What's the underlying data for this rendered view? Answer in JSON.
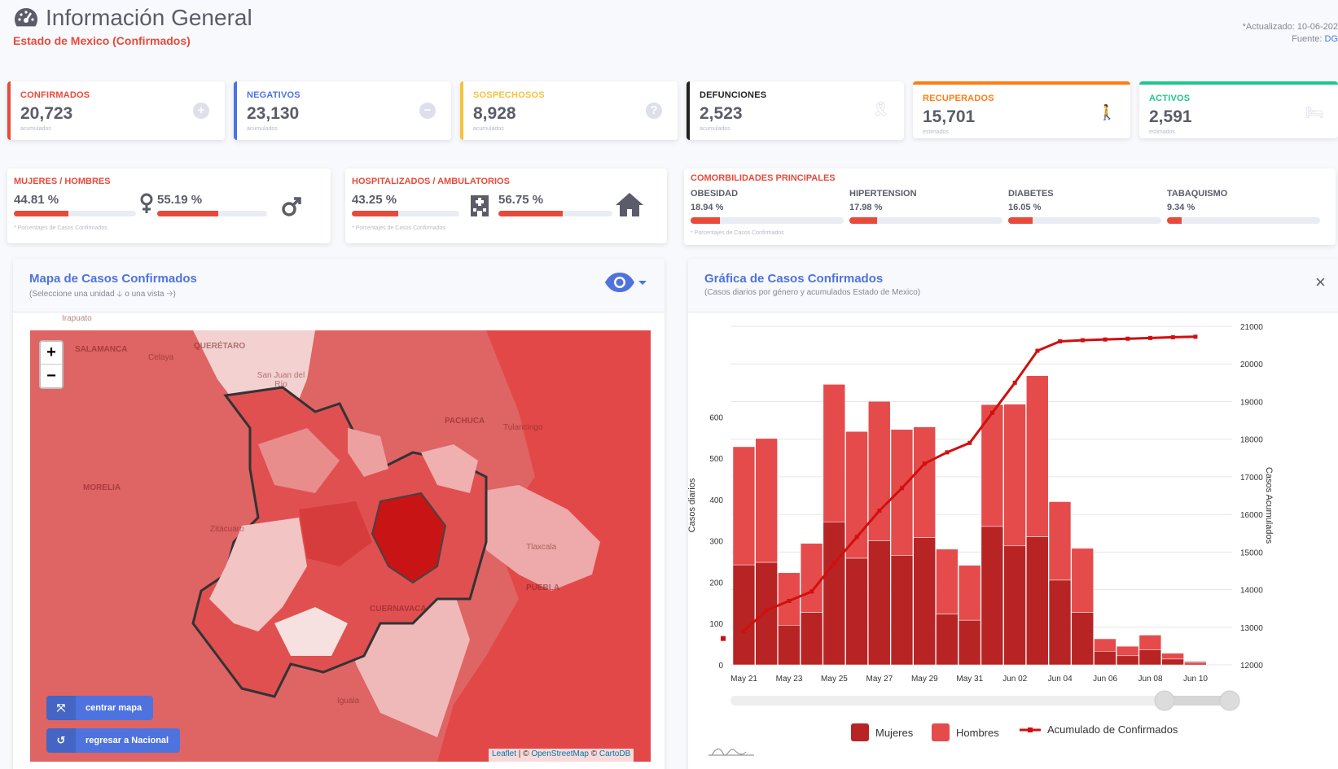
{
  "header": {
    "title": "Información General",
    "subtitle": "Estado de Mexico (Confirmados)",
    "updated": "*Actualizado: 10-06-202",
    "source_label": "Fuente:",
    "source_link": "DG"
  },
  "stats": [
    {
      "label": "CONFIRMADOS",
      "value": "20,723",
      "sub": "acumulados",
      "color": "#e74a3b",
      "icon": "plus-circle-icon"
    },
    {
      "label": "NEGATIVOS",
      "value": "23,130",
      "sub": "acumulados",
      "color": "#4e73df",
      "icon": "minus-circle-icon"
    },
    {
      "label": "SOSPECHOSOS",
      "value": "8,928",
      "sub": "acumulados",
      "color": "#f6c23e",
      "icon": "question-circle-icon"
    },
    {
      "label": "DEFUNCIONES",
      "value": "2,523",
      "sub": "acumulados",
      "color": "#222222",
      "icon": "ribbon-icon"
    },
    {
      "label": "RECUPERADOS",
      "value": "15,701",
      "sub": "estimados",
      "color": "#fd7e14",
      "icon": "walking-icon"
    },
    {
      "label": "ACTIVOS",
      "value": "2,591",
      "sub": "estimados",
      "color": "#1cc88a",
      "icon": "bed-icon"
    }
  ],
  "gender": {
    "title": "MUJERES / HOMBRES",
    "women_pct": "44.81 %",
    "women_value": 44.81,
    "men_pct": "55.19 %",
    "men_value": 55.19,
    "note": "* Porcentajes  de Casos Confirmados"
  },
  "hosp": {
    "title": "HOSPITALIZADOS / AMBULATORIOS",
    "hosp_pct": "43.25 %",
    "hosp_value": 43.25,
    "amb_pct": "56.75 %",
    "amb_value": 56.75,
    "note": "* Porcentajes  de Casos Confirmados"
  },
  "comorb": {
    "title": "COMORBILIDADES PRINCIPALES",
    "items": [
      {
        "label": "OBESIDAD",
        "pct": "18.94 %",
        "value": 18.94
      },
      {
        "label": "HIPERTENSION",
        "pct": "17.98 %",
        "value": 17.98
      },
      {
        "label": "DIABETES",
        "pct": "16.05 %",
        "value": 16.05
      },
      {
        "label": "TABAQUISMO",
        "pct": "9.34 %",
        "value": 9.34
      }
    ],
    "note": "* Porcentajes  de Casos Confirmados"
  },
  "map_panel": {
    "title": "Mapa de Casos Confirmados",
    "subtitle": "(Seleccione una unidad 🡣 o una vista 🡢)",
    "zoom_in": "+",
    "zoom_out": "−",
    "center_btn": "centrar mapa",
    "back_btn": "regresar a Nacional",
    "attr_leaflet": "Leaflet",
    "attr_rest": " | © ",
    "attr_osm": "OpenStreetMap",
    "attr_sep": " © ",
    "attr_carto": "CartoDB",
    "places": [
      "Irapuato",
      "SALAMANCA",
      "QUERÉTARO",
      "Celaya",
      "San Juan del Río",
      "PACHUCA",
      "Tulancingo",
      "MORELIA",
      "Zitácuaro",
      "Tlaxcala",
      "PUEBLA",
      "CUERNAVACA",
      "Iguala"
    ]
  },
  "chart_panel": {
    "title": "Gráfica de Casos Confirmados",
    "subtitle": "(Casos diarios por género y acumulados Estado de Mexico)",
    "close": "×"
  },
  "chart_data": {
    "type": "bar",
    "ylabel": "Casos diarios",
    "y2label": "Casos Acumulados",
    "ylim": [
      0,
      800
    ],
    "y2lim": [
      12000,
      21000
    ],
    "yticks": [
      0,
      100,
      200,
      300,
      400,
      500,
      600
    ],
    "y2ticks": [
      12000,
      13000,
      14000,
      15000,
      16000,
      17000,
      18000,
      19000,
      20000,
      21000
    ],
    "x_tick_labels": [
      "May 21",
      "May 23",
      "May 25",
      "May 27",
      "May 29",
      "May 31",
      "Jun 02",
      "Jun 04",
      "Jun 06",
      "Jun 08",
      "Jun 10"
    ],
    "categories": [
      "May 21",
      "May 22",
      "May 23",
      "May 24",
      "May 25",
      "May 26",
      "May 27",
      "May 28",
      "May 29",
      "May 30",
      "May 31",
      "Jun 01",
      "Jun 02",
      "Jun 03",
      "Jun 04",
      "Jun 05",
      "Jun 06",
      "Jun 07",
      "Jun 08",
      "Jun 09",
      "Jun 10"
    ],
    "series": [
      {
        "name": "Mujeres",
        "type": "bar",
        "color": "#b82424",
        "values": [
          242,
          248,
          96,
          127,
          346,
          258,
          300,
          265,
          308,
          123,
          108,
          335,
          288,
          310,
          205,
          127,
          33,
          22,
          36,
          14,
          4
        ]
      },
      {
        "name": "Hombres",
        "type": "bar",
        "color": "#e54b4b",
        "values": [
          286,
          300,
          127,
          167,
          333,
          307,
          338,
          305,
          268,
          157,
          133,
          295,
          343,
          390,
          190,
          155,
          30,
          23,
          36,
          14,
          4
        ]
      },
      {
        "name": "Acumulado de Confirmados",
        "type": "line",
        "color": "#d01010",
        "values": [
          12900,
          13450,
          13700,
          13950,
          14700,
          15400,
          16100,
          16700,
          17350,
          17650,
          17900,
          18700,
          19500,
          20350,
          20600,
          20630,
          20650,
          20670,
          20690,
          20710,
          20723
        ]
      }
    ]
  }
}
